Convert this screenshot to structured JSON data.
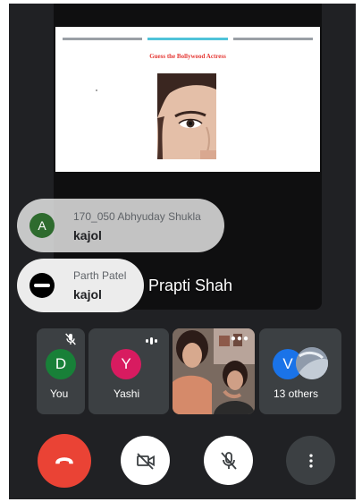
{
  "slide": {
    "title": "Guess the Bollywood Actress"
  },
  "presenter": {
    "name": "Prapti Shah"
  },
  "chat": [
    {
      "initial": "A",
      "sender": "170_050 Abhyuday Shukla",
      "message": "kajol"
    },
    {
      "initial": "",
      "sender": "Parth Patel",
      "message": "kajol"
    }
  ],
  "participants": {
    "you": {
      "initial": "D",
      "label": "You"
    },
    "yashi": {
      "initial": "Y",
      "label": "Yashi"
    },
    "others": {
      "initial": "V",
      "label": "13 others"
    }
  },
  "colors": {
    "background": "#202124",
    "end_call": "#ea4335",
    "you_avatar": "#188038",
    "yashi_avatar": "#d81b60",
    "others_avatar": "#1a73e8",
    "chat_avatar": "#2e6b2e",
    "slide_title": "#e53935"
  },
  "icons": {
    "end_call": "phone-hangup-icon",
    "camera": "video-off-icon",
    "mic": "mic-off-icon",
    "more": "more-vertical-icon"
  }
}
